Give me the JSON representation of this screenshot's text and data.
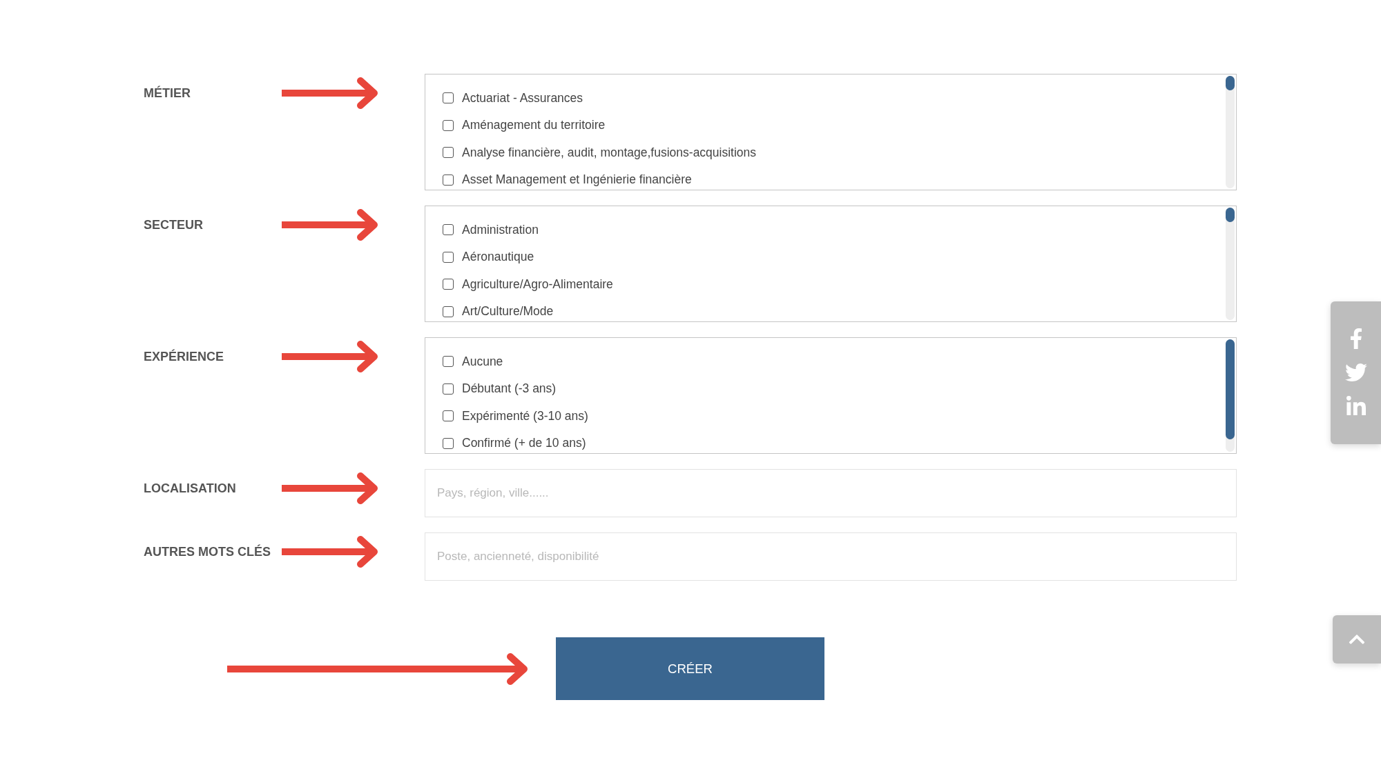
{
  "form": {
    "fields": [
      {
        "kind": "checklist",
        "label": "MÉTIER",
        "options": [
          {
            "label": "Actuariat - Assurances",
            "checked": false
          },
          {
            "label": "Aménagement du territoire",
            "checked": false
          },
          {
            "label": "Analyse financière, audit, montage,fusions-acquisitions",
            "checked": false
          },
          {
            "label": "Asset Management et Ingénierie financière",
            "checked": false
          }
        ]
      },
      {
        "kind": "checklist",
        "label": "SECTEUR",
        "options": [
          {
            "label": "Administration",
            "checked": false
          },
          {
            "label": "Aéronautique",
            "checked": false
          },
          {
            "label": "Agriculture/Agro-Alimentaire",
            "checked": false
          },
          {
            "label": "Art/Culture/Mode",
            "checked": false
          }
        ]
      },
      {
        "kind": "checklist",
        "label": "EXPÉRIENCE",
        "options": [
          {
            "label": "Aucune",
            "checked": false
          },
          {
            "label": "Débutant (-3 ans)",
            "checked": false
          },
          {
            "label": "Expérimenté (3-10 ans)",
            "checked": false
          },
          {
            "label": "Confirmé (+ de 10 ans)",
            "checked": false
          }
        ]
      },
      {
        "kind": "text",
        "label": "LOCALISATION",
        "placeholder": "Pays, région, ville......"
      },
      {
        "kind": "text",
        "label": "AUTRES MOTS CLÉS",
        "placeholder": "Poste, ancienneté, disponibilité"
      }
    ],
    "submit_button": "CRÉER"
  }
}
